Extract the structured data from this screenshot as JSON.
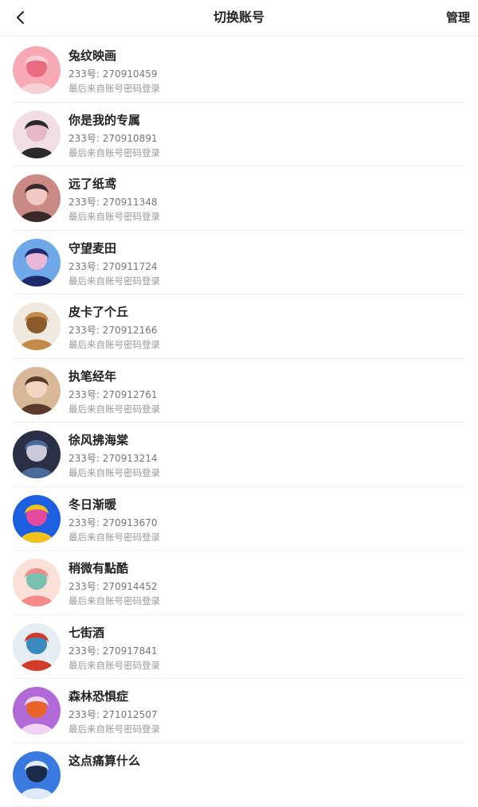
{
  "header": {
    "title": "切换账号",
    "manage_label": "管理",
    "back_icon": "chevron-left-icon"
  },
  "accounts": [
    {
      "name": "兔纹映画",
      "uid_label": "233号: 270910459",
      "login_note": "最后来自账号密码登录",
      "avatar_colors": [
        "#f7a9b4",
        "#f4d1d6",
        "#e86b80"
      ]
    },
    {
      "name": "你是我的专属",
      "uid_label": "233号: 270910891",
      "login_note": "最后来自账号密码登录",
      "avatar_colors": [
        "#f1dfe4",
        "#2a2a2a",
        "#e8b9c4"
      ]
    },
    {
      "name": "远了纸鸢",
      "uid_label": "233号: 270911348",
      "login_note": "最后来自账号密码登录",
      "avatar_colors": [
        "#c98a86",
        "#3b2a2a",
        "#f0c9c2"
      ]
    },
    {
      "name": "守望麦田",
      "uid_label": "233号: 270911724",
      "login_note": "最后来自账号密码登录",
      "avatar_colors": [
        "#6fa8e8",
        "#1e2a6b",
        "#e9b7d6"
      ]
    },
    {
      "name": "皮卡了个丘",
      "uid_label": "233号: 270912166",
      "login_note": "最后来自账号密码登录",
      "avatar_colors": [
        "#efe9df",
        "#c48a4a",
        "#8a5a2a"
      ]
    },
    {
      "name": "执笔经年",
      "uid_label": "233号: 270912761",
      "login_note": "最后来自账号密码登录",
      "avatar_colors": [
        "#d9b89a",
        "#5a3a2a",
        "#f3d6c2"
      ]
    },
    {
      "name": "徐风拂海棠",
      "uid_label": "233号: 270913214",
      "login_note": "最后来自账号密码登录",
      "avatar_colors": [
        "#2a2f45",
        "#4a6a9a",
        "#c9c9d9"
      ]
    },
    {
      "name": "冬日渐暖",
      "uid_label": "233号: 270913670",
      "login_note": "最后来自账号密码登录",
      "avatar_colors": [
        "#1c5fe0",
        "#f4c21a",
        "#e44aa0"
      ]
    },
    {
      "name": "稍微有點酷",
      "uid_label": "233号: 270914452",
      "login_note": "最后来自账号密码登录",
      "avatar_colors": [
        "#fbe0d8",
        "#f48a8a",
        "#7ac0b0"
      ]
    },
    {
      "name": "七街酒",
      "uid_label": "233号: 270917841",
      "login_note": "最后来自账号密码登录",
      "avatar_colors": [
        "#e6edf3",
        "#d23a2a",
        "#3a8ac0"
      ]
    },
    {
      "name": "森林恐惧症",
      "uid_label": "233号: 271012507",
      "login_note": "最后来自账号密码登录",
      "avatar_colors": [
        "#b26ad9",
        "#f0d4f4",
        "#e8642a"
      ]
    },
    {
      "name": "这点痛算什么",
      "uid_label": "",
      "login_note": "",
      "avatar_colors": [
        "#3a7ae0",
        "#dfe9f7",
        "#1a2a4a"
      ]
    }
  ]
}
